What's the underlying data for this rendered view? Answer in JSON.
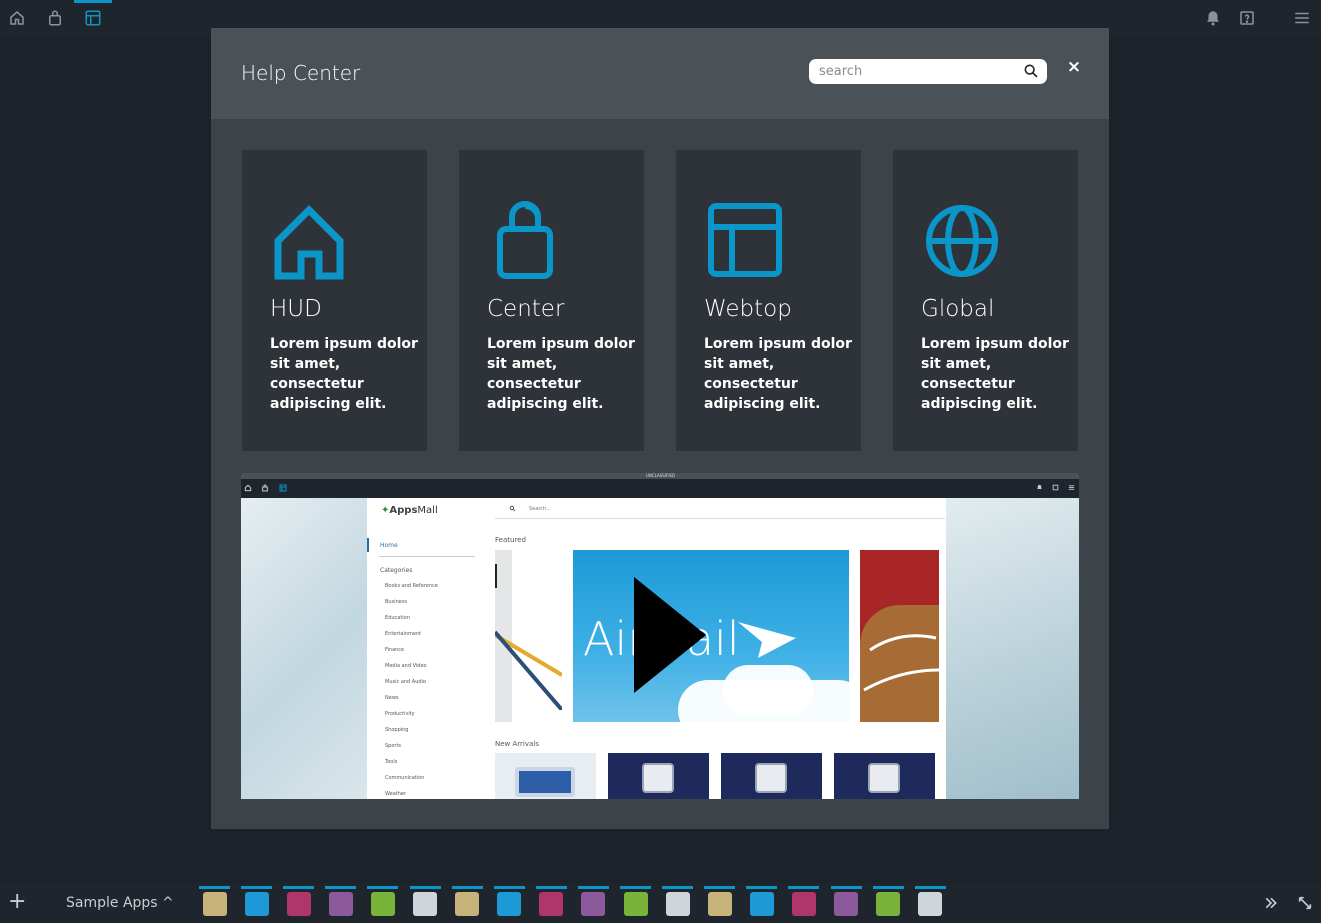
{
  "topbar": {
    "home_icon": "home-icon",
    "center_icon": "shopping-bag-icon",
    "webtop_icon": "webtop-layout-icon",
    "notifications_icon": "bell-icon",
    "help_icon": "help-icon",
    "menu_icon": "hamburger-menu-icon"
  },
  "modal": {
    "title": "Help Center",
    "search_placeholder": "search",
    "search_value": "",
    "close_label": "×"
  },
  "cards": [
    {
      "title": "HUD",
      "description": "Lorem ipsum dolor sit amet, consectetur adipiscing elit.",
      "icon": "home-icon"
    },
    {
      "title": "Center",
      "description": "Lorem ipsum dolor sit amet, consectetur adipiscing elit.",
      "icon": "shopping-bag-icon"
    },
    {
      "title": "Webtop",
      "description": "Lorem ipsum dolor sit amet, consectetur adipiscing elit.",
      "icon": "webtop-layout-icon"
    },
    {
      "title": "Global",
      "description": "Lorem ipsum dolor sit amet, consectetur adipiscing elit.",
      "icon": "globe-icon"
    }
  ],
  "video": {
    "banner": "UNCLASSIFIED",
    "logo_prefix": "Apps",
    "logo_suffix": "Mall",
    "search_placeholder": "Search...",
    "home": "Home",
    "categories_heading": "Categories",
    "categories": [
      "Books and Reference",
      "Business",
      "Education",
      "Entertainment",
      "Finance",
      "Media and Video",
      "Music and Audio",
      "News",
      "Productivity",
      "Shopping",
      "Sports",
      "Tools",
      "Communication",
      "Weather"
    ],
    "featured": "Featured",
    "new_arrivals": "New Arrivals",
    "featured_banner": "AirMail"
  },
  "bottombar": {
    "add_label": "+",
    "app_group_label": "Sample Apps ^",
    "apps": [
      {
        "name": "pencil-app",
        "color": "#c7b27a"
      },
      {
        "name": "airmail-app",
        "color": "#1d9ad6"
      },
      {
        "name": "settings-app",
        "color": "#b0356a"
      },
      {
        "name": "clipboard-app",
        "color": "#8c5a9c"
      },
      {
        "name": "chat-app",
        "color": "#7ab33a"
      },
      {
        "name": "map-pin-app",
        "color": "#cfd6db"
      },
      {
        "name": "pencil-app",
        "color": "#c7b27a"
      },
      {
        "name": "airmail-app",
        "color": "#1d9ad6"
      },
      {
        "name": "settings-app",
        "color": "#b0356a"
      },
      {
        "name": "clipboard-app",
        "color": "#8c5a9c"
      },
      {
        "name": "chat-app",
        "color": "#7ab33a"
      },
      {
        "name": "map-pin-app",
        "color": "#cfd6db"
      },
      {
        "name": "pencil-app",
        "color": "#c7b27a"
      },
      {
        "name": "airmail-app",
        "color": "#1d9ad6"
      },
      {
        "name": "settings-app",
        "color": "#b0356a"
      },
      {
        "name": "clipboard-app",
        "color": "#8c5a9c"
      },
      {
        "name": "chat-app",
        "color": "#7ab33a"
      },
      {
        "name": "map-pin-app",
        "color": "#cfd6db"
      }
    ],
    "more_icon": "double-chevron-right-icon",
    "expand_icon": "expand-arrows-icon"
  },
  "colors": {
    "accent": "#0a96c8",
    "background": "#1c222a",
    "modal": "#3c4349",
    "card": "#2e3339"
  }
}
